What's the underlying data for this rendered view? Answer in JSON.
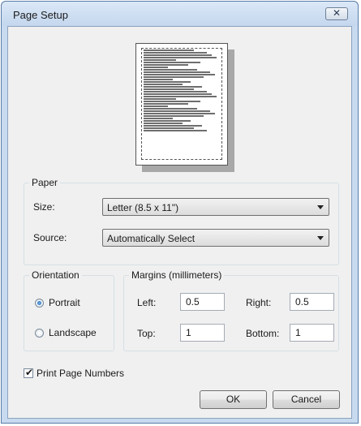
{
  "window": {
    "title": "Page Setup",
    "close_glyph": "✕"
  },
  "preview": {
    "sample_line_count": 34
  },
  "paper": {
    "group_title": "Paper",
    "size_label": "Size:",
    "size_value": "Letter (8.5 x 11\")",
    "source_label": "Source:",
    "source_value": "Automatically Select"
  },
  "orientation": {
    "group_title": "Orientation",
    "portrait_label": "Portrait",
    "landscape_label": "Landscape",
    "selected": "portrait"
  },
  "margins": {
    "group_title": "Margins (millimeters)",
    "left_label": "Left:",
    "left_value": "0.5",
    "right_label": "Right:",
    "right_value": "0.5",
    "top_label": "Top:",
    "top_value": "1",
    "bottom_label": "Bottom:",
    "bottom_value": "1"
  },
  "print_page_numbers": {
    "label": "Print Page Numbers",
    "checked": true,
    "check_glyph": "✔"
  },
  "buttons": {
    "ok_label": "OK",
    "cancel_label": "Cancel"
  }
}
